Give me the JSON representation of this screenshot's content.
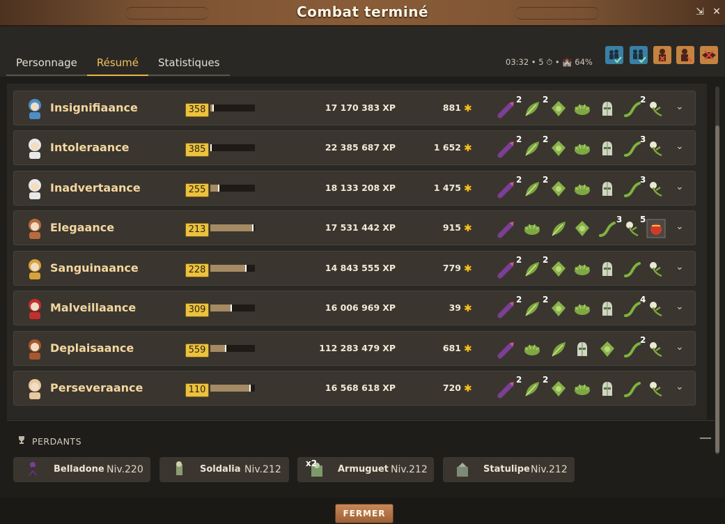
{
  "window": {
    "title": "Combat terminé"
  },
  "tabs": [
    {
      "label": "Personnage",
      "active": false
    },
    {
      "label": "Résumé",
      "active": true
    },
    {
      "label": "Statistiques",
      "active": false
    }
  ],
  "stats": {
    "text": "03:32 • 5 ⏱ • 🏰 64%"
  },
  "toolbar_icons": [
    "party-up-icon",
    "party-check-icon",
    "fighter-icon",
    "fighter-cross-icon",
    "handshake-cross-icon"
  ],
  "winners": [
    {
      "name": "Insignifiaance",
      "level": "358",
      "xp_progress": 0.08,
      "xp": "17 170 383",
      "xp_unit": "XP",
      "kamas": "881",
      "loot": [
        {
          "qty": "",
          "icon": "wand"
        },
        {
          "qty": "2",
          "icon": "leaf"
        },
        {
          "qty": "2",
          "icon": "herb-bundle"
        },
        {
          "qty": "",
          "icon": "moss"
        },
        {
          "qty": "",
          "icon": "helmet"
        },
        {
          "qty": "",
          "icon": "vine"
        },
        {
          "qty": "2",
          "icon": "flower"
        }
      ]
    },
    {
      "name": "Intoleraance",
      "level": "385",
      "xp_progress": 0.02,
      "xp": "22 385 687",
      "xp_unit": "XP",
      "kamas": "1 652",
      "loot": [
        {
          "qty": "",
          "icon": "wand"
        },
        {
          "qty": "2",
          "icon": "leaf"
        },
        {
          "qty": "2",
          "icon": "herb-bundle"
        },
        {
          "qty": "",
          "icon": "moss"
        },
        {
          "qty": "",
          "icon": "helmet"
        },
        {
          "qty": "",
          "icon": "vine"
        },
        {
          "qty": "3",
          "icon": "flower"
        }
      ]
    },
    {
      "name": "Inadvertaance",
      "level": "255",
      "xp_progress": 0.2,
      "xp": "18 133 208",
      "xp_unit": "XP",
      "kamas": "1 475",
      "loot": [
        {
          "qty": "",
          "icon": "wand"
        },
        {
          "qty": "2",
          "icon": "leaf"
        },
        {
          "qty": "2",
          "icon": "herb-bundle"
        },
        {
          "qty": "",
          "icon": "moss"
        },
        {
          "qty": "",
          "icon": "helmet"
        },
        {
          "qty": "",
          "icon": "vine"
        },
        {
          "qty": "3",
          "icon": "flower"
        }
      ]
    },
    {
      "name": "Elegaance",
      "level": "213",
      "xp_progress": 0.97,
      "xp": "17 531 442",
      "xp_unit": "XP",
      "kamas": "915",
      "loot": [
        {
          "qty": "",
          "icon": "wand"
        },
        {
          "qty": "",
          "icon": "moss"
        },
        {
          "qty": "",
          "icon": "leaf"
        },
        {
          "qty": "",
          "icon": "herb-bundle"
        },
        {
          "qty": "",
          "icon": "vine"
        },
        {
          "qty": "3",
          "icon": "flower"
        },
        {
          "qty": "5",
          "icon": "red-resource"
        }
      ]
    },
    {
      "name": "Sanguinaance",
      "level": "228",
      "xp_progress": 0.82,
      "xp": "14 843 555",
      "xp_unit": "XP",
      "kamas": "779",
      "loot": [
        {
          "qty": "",
          "icon": "wand"
        },
        {
          "qty": "2",
          "icon": "leaf"
        },
        {
          "qty": "2",
          "icon": "herb-bundle"
        },
        {
          "qty": "",
          "icon": "moss"
        },
        {
          "qty": "",
          "icon": "helmet"
        },
        {
          "qty": "",
          "icon": "vine"
        },
        {
          "qty": "",
          "icon": "flower"
        }
      ]
    },
    {
      "name": "Malveillaance",
      "level": "309",
      "xp_progress": 0.48,
      "xp": "16 006 969",
      "xp_unit": "XP",
      "kamas": "39",
      "loot": [
        {
          "qty": "",
          "icon": "wand"
        },
        {
          "qty": "2",
          "icon": "leaf"
        },
        {
          "qty": "2",
          "icon": "herb-bundle"
        },
        {
          "qty": "",
          "icon": "moss"
        },
        {
          "qty": "",
          "icon": "helmet"
        },
        {
          "qty": "",
          "icon": "vine"
        },
        {
          "qty": "4",
          "icon": "flower"
        }
      ]
    },
    {
      "name": "Deplaisaance",
      "level": "559",
      "xp_progress": 0.36,
      "xp": "112 283 479",
      "xp_unit": "XP",
      "kamas": "681",
      "loot": [
        {
          "qty": "",
          "icon": "wand"
        },
        {
          "qty": "",
          "icon": "moss"
        },
        {
          "qty": "",
          "icon": "leaf"
        },
        {
          "qty": "",
          "icon": "helmet"
        },
        {
          "qty": "",
          "icon": "herb-bundle"
        },
        {
          "qty": "",
          "icon": "vine"
        },
        {
          "qty": "2",
          "icon": "flower"
        }
      ]
    },
    {
      "name": "Perseveraance",
      "level": "110",
      "xp_progress": 0.9,
      "xp": "16 568 618",
      "xp_unit": "XP",
      "kamas": "720",
      "loot": [
        {
          "qty": "",
          "icon": "wand"
        },
        {
          "qty": "2",
          "icon": "leaf"
        },
        {
          "qty": "2",
          "icon": "herb-bundle"
        },
        {
          "qty": "",
          "icon": "moss"
        },
        {
          "qty": "",
          "icon": "helmet"
        },
        {
          "qty": "",
          "icon": "vine"
        },
        {
          "qty": "",
          "icon": "flower"
        }
      ]
    }
  ],
  "losers_section": {
    "label": "PERDANTS"
  },
  "losers": [
    {
      "name": "Belladone",
      "level": "Niv.220",
      "qty": ""
    },
    {
      "name": "Soldalia",
      "level": "Niv.212",
      "qty": ""
    },
    {
      "name": "Armuguet",
      "level": "Niv.212",
      "qty": "x2"
    },
    {
      "name": "Statulipe",
      "level": "Niv.212",
      "qty": ""
    }
  ],
  "footer": {
    "close_label": "FERMER"
  }
}
